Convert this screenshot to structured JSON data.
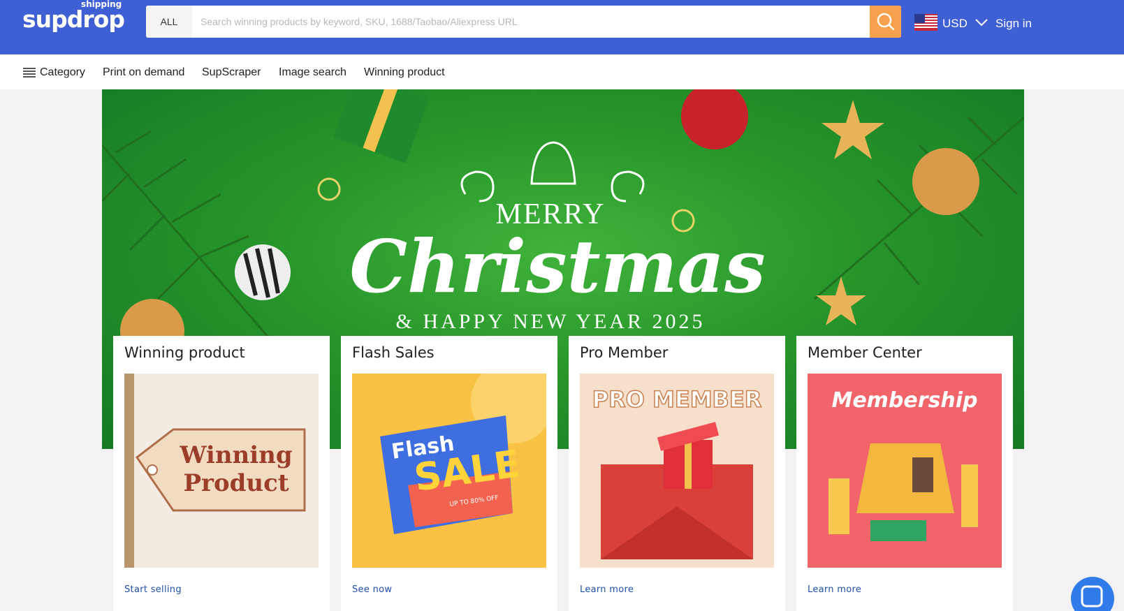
{
  "header": {
    "logo_text": "supdrop",
    "logo_sub": "shipping",
    "search_category": "ALL",
    "search_placeholder": "Search winning products by keyword, SKU, 1688/Taobao/Aliexpress URL",
    "search_icon": "search-icon",
    "flag_icon": "us-flag-icon",
    "currency": "USD",
    "signin": "Sign in",
    "colors": {
      "brand": "#3f5fd4",
      "accent": "#f7a14c"
    }
  },
  "nav": {
    "category": "Category",
    "items": [
      "Print on demand",
      "SupScraper",
      "Image search",
      "Winning product"
    ]
  },
  "banner": {
    "line1": "MERRY",
    "line2": "Christmas",
    "line3": "& HAPPY NEW YEAR 2025"
  },
  "cards": [
    {
      "title": "Winning product",
      "image_text": [
        "Winning",
        "Product"
      ],
      "link": "Start selling"
    },
    {
      "title": "Flash Sales",
      "image_text": [
        "Flash",
        "SALE",
        "UP TO 80% OFF"
      ],
      "link": "See now"
    },
    {
      "title": "Pro Member",
      "image_text": [
        "PRO MEMBER"
      ],
      "link": "Learn more"
    },
    {
      "title": "Member Center",
      "image_text": [
        "Membership"
      ],
      "link": "Learn more"
    }
  ],
  "chat_icon": "chat-bubble-icon"
}
